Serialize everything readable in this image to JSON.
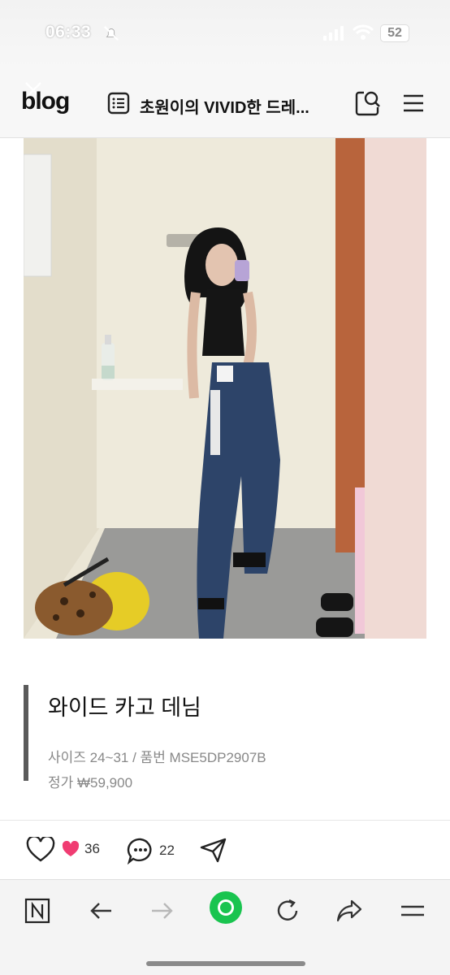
{
  "status": {
    "time": "06:33",
    "battery": "52"
  },
  "header": {
    "logo": "blog",
    "title": "초원이의 VIVID한 드레..."
  },
  "post": {
    "caption_title": "와이드 카고 데님",
    "caption_detail": "사이즈 24~31 / 품번 MSE5DP2907B",
    "caption_price": "정가 ₩59,900"
  },
  "actions": {
    "like_count": "36",
    "comment_count": "22"
  },
  "colors": {
    "accent_green": "#19c44f",
    "heart_pink": "#f03c72"
  }
}
